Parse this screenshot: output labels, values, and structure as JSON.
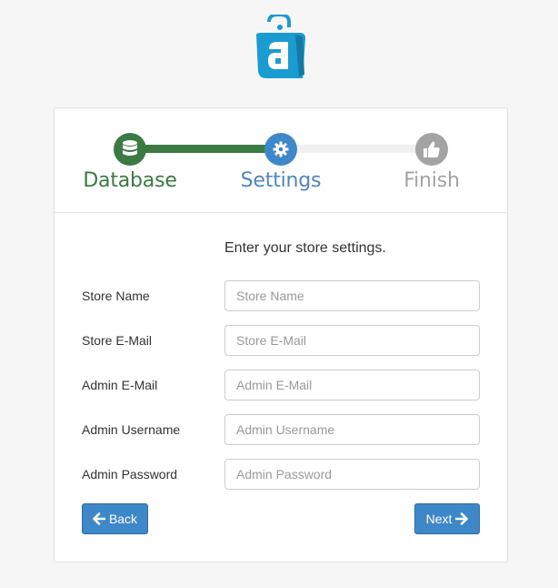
{
  "steps": [
    {
      "label": "Database",
      "icon": "database-icon",
      "state": "done",
      "color": "#3c7a43"
    },
    {
      "label": "Settings",
      "icon": "gear-icon",
      "state": "active",
      "color": "#3e87c8"
    },
    {
      "label": "Finish",
      "icon": "thumbs-up-icon",
      "state": "pending",
      "color": "#a3a3a3"
    }
  ],
  "form": {
    "intro": "Enter your store settings.",
    "fields": [
      {
        "label": "Store Name",
        "placeholder": "Store Name",
        "value": ""
      },
      {
        "label": "Store E-Mail",
        "placeholder": "Store E-Mail",
        "value": ""
      },
      {
        "label": "Admin E-Mail",
        "placeholder": "Admin E-Mail",
        "value": ""
      },
      {
        "label": "Admin Username",
        "placeholder": "Admin Username",
        "value": ""
      },
      {
        "label": "Admin Password",
        "placeholder": "Admin Password",
        "value": ""
      }
    ]
  },
  "buttons": {
    "back_label": "Back",
    "next_label": "Next"
  },
  "colors": {
    "accent": "#3e87c8",
    "done": "#3c7a43",
    "logo": "#1a9cd0"
  }
}
